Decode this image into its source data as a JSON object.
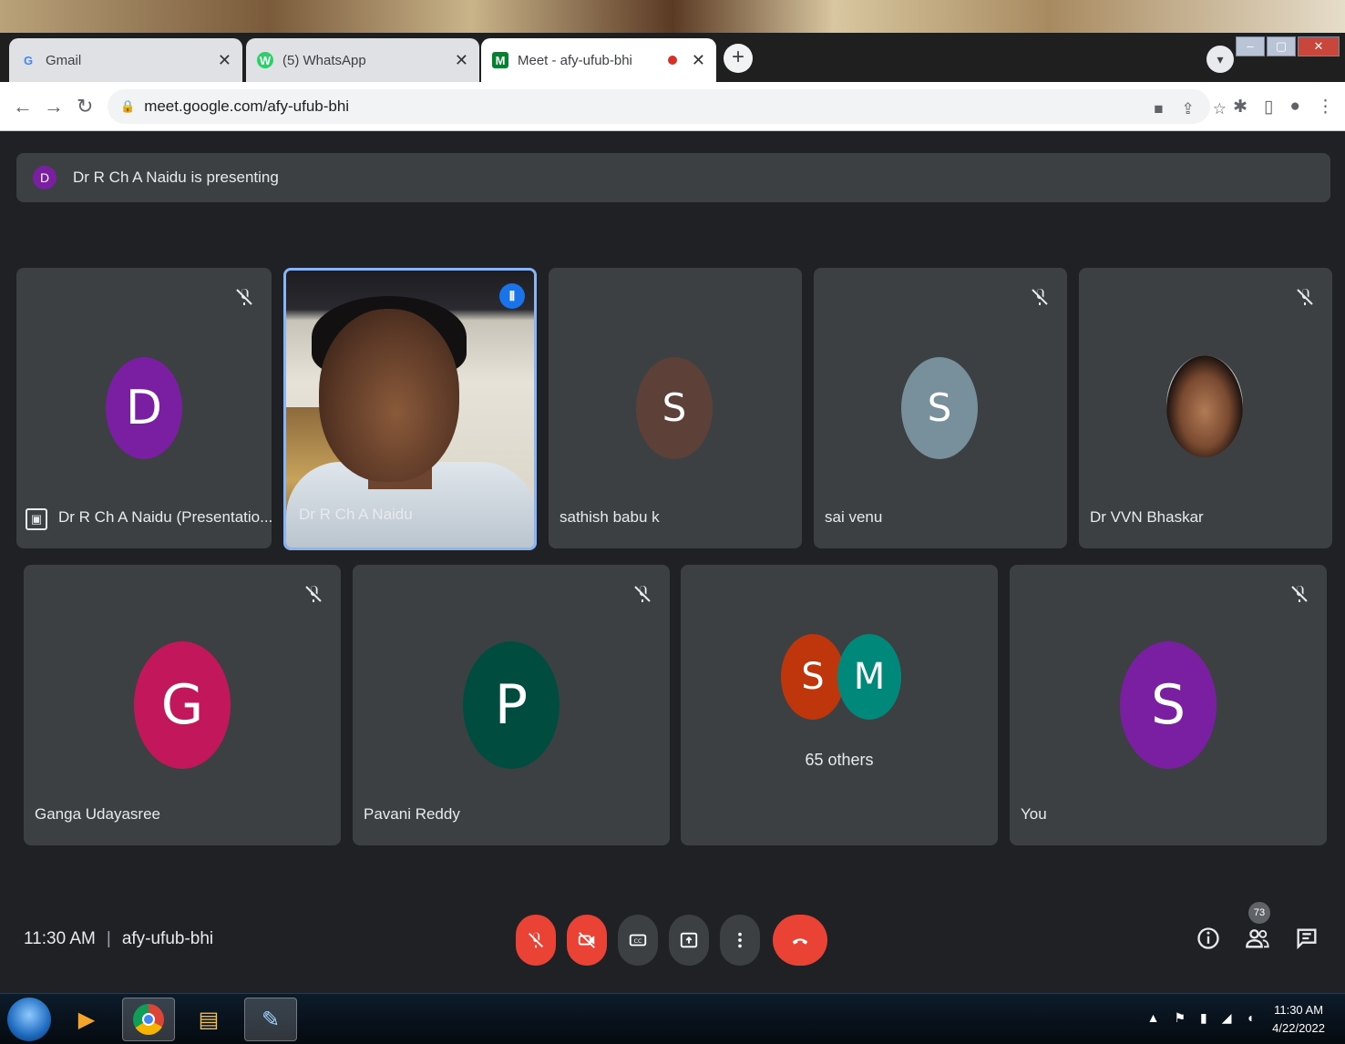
{
  "browser": {
    "tabs": [
      {
        "label": "Gmail",
        "favicon": "G",
        "favicon_color": "#4285f4"
      },
      {
        "label": "(5) WhatsApp",
        "favicon": "W",
        "favicon_color": "#25d366"
      },
      {
        "label": "Meet - afy-ufub-bhi",
        "favicon": "M",
        "favicon_color": "#00832d"
      }
    ],
    "url": "meet.google.com/afy-ufub-bhi"
  },
  "meet": {
    "presenting_banner": {
      "avatar_letter": "D",
      "text": "Dr R Ch A Naidu is presenting"
    },
    "tiles_row1": [
      {
        "name": "Dr R Ch A Naidu (Presentatio...",
        "avatar_letter": "D",
        "avatar_color": "#7b1fa2"
      },
      {
        "name": "Dr R Ch A Naidu",
        "speaking": true
      },
      {
        "name": "sathish babu k",
        "avatar_letter": "S",
        "avatar_color": "#5d4037"
      },
      {
        "name": "sai venu",
        "avatar_letter": "S",
        "avatar_color": "#78909c"
      },
      {
        "name": "Dr VVN Bhaskar"
      }
    ],
    "tiles_row2": [
      {
        "name": "Ganga Udayasree",
        "avatar_letter": "G",
        "avatar_color": "#c2185b"
      },
      {
        "name": "Pavani Reddy",
        "avatar_letter": "P",
        "avatar_color": "#004d40"
      },
      {
        "others_letters": [
          "S",
          "M"
        ],
        "others_colors": [
          "#bf360c",
          "#00897b"
        ],
        "others_label": "65 others"
      },
      {
        "name": "You",
        "avatar_letter": "S",
        "avatar_color": "#7b1fa2"
      }
    ],
    "bottom": {
      "time": "11:30 AM",
      "separator": "|",
      "meeting_code": "afy-ufub-bhi",
      "participants_count": "73"
    }
  },
  "taskbar": {
    "clock_time": "11:30 AM",
    "clock_date": "4/22/2022"
  }
}
